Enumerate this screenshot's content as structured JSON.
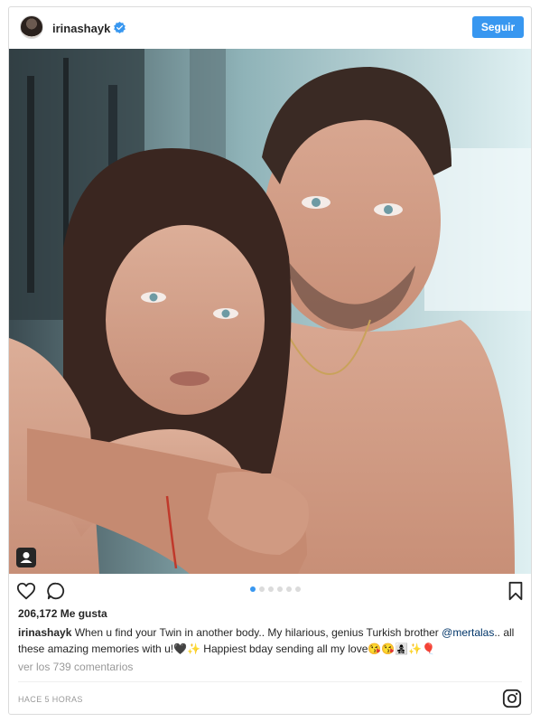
{
  "post": {
    "username": "irinashayk",
    "follow_label": "Seguir",
    "likes": "206,172 Me gusta",
    "caption": {
      "username": "irinashayk",
      "text_before_mention": " When u find your Twin in another body.. My hilarious, genius Turkish brother ",
      "mention": "@mertalas",
      "text_after_mention": ".. all these amazing memories with u!🖤✨ Happiest bday sending all my love😘😘👩‍👧‍👦✨🎈"
    },
    "view_comments": "ver los 739 comentarios",
    "timestamp": "HACE 5 HORAS",
    "carousel": {
      "count": 6,
      "active_index": 0
    }
  },
  "colors": {
    "accent": "#3897f0",
    "text": "#262626",
    "muted": "#999999",
    "border": "#dbdbdb",
    "mention": "#003569"
  },
  "icons": {
    "verified": "verified-badge-icon",
    "like": "heart-icon",
    "comment": "comment-icon",
    "save": "bookmark-icon",
    "tag": "user-tag-icon",
    "brand": "instagram-icon"
  }
}
